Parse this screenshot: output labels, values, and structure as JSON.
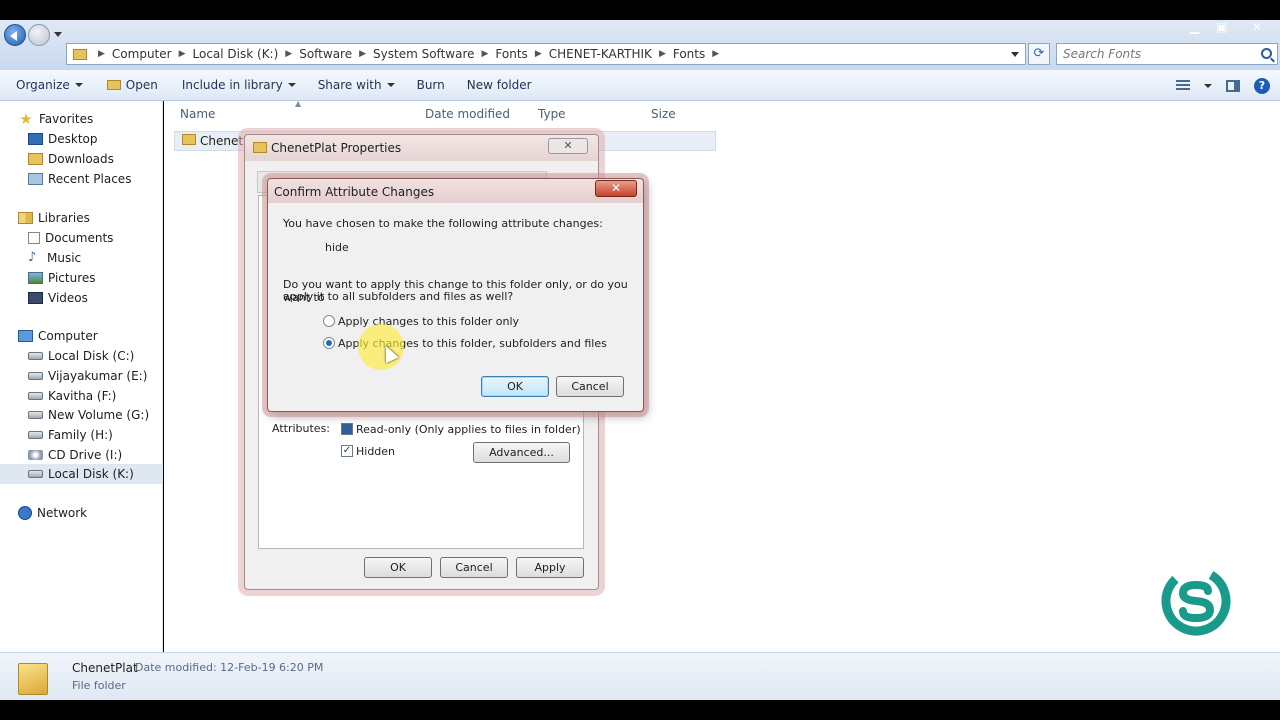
{
  "addressbar": {
    "crumbs": [
      "Computer",
      "Local Disk (K:)",
      "Software",
      "System Software",
      "Fonts",
      "CHENET-KARTHIK",
      "Fonts"
    ],
    "search_placeholder": "Search Fonts"
  },
  "toolbar": {
    "organize": "Organize",
    "open": "Open",
    "include": "Include in library",
    "share": "Share with",
    "burn": "Burn",
    "newfolder": "New folder"
  },
  "nav": {
    "favorites": "Favorites",
    "desktop": "Desktop",
    "downloads": "Downloads",
    "recent": "Recent Places",
    "libraries": "Libraries",
    "documents": "Documents",
    "music": "Music",
    "pictures": "Pictures",
    "videos": "Videos",
    "computer": "Computer",
    "drive_c": "Local Disk (C:)",
    "drive_e": "Vijayakumar (E:)",
    "drive_f": "Kavitha (F:)",
    "drive_g": "New Volume (G:)",
    "drive_h": "Family (H:)",
    "drive_i": "CD Drive (I:)",
    "drive_k": "Local Disk (K:)",
    "network": "Network"
  },
  "columns": {
    "name": "Name",
    "modified": "Date modified",
    "type": "Type",
    "size": "Size"
  },
  "file_row": {
    "name": "ChenetPl"
  },
  "details": {
    "name": "ChenetPlat",
    "meta": "Date modified: 12-Feb-19 6:20 PM",
    "type": "File folder"
  },
  "properties": {
    "title": "ChenetPlat Properties",
    "attributes_label": "Attributes:",
    "readonly_label": "Read-only (Only applies to files in folder)",
    "hidden_label": "Hidden",
    "advanced": "Advanced...",
    "ok": "OK",
    "cancel": "Cancel",
    "apply": "Apply"
  },
  "confirm": {
    "title": "Confirm Attribute Changes",
    "intro": "You have chosen to make the following attribute changes:",
    "change": "hide",
    "question_line1": "Do you want to apply this change to this folder only, or do you want to",
    "question_line2": "apply it to all subfolders and files as well?",
    "option1": "Apply changes to this folder only",
    "option2": "Apply changes to this folder, subfolders and files",
    "ok": "OK",
    "cancel": "Cancel"
  },
  "colors": {
    "accent": "#1e5cb3",
    "logo": "#1a9a8a"
  }
}
